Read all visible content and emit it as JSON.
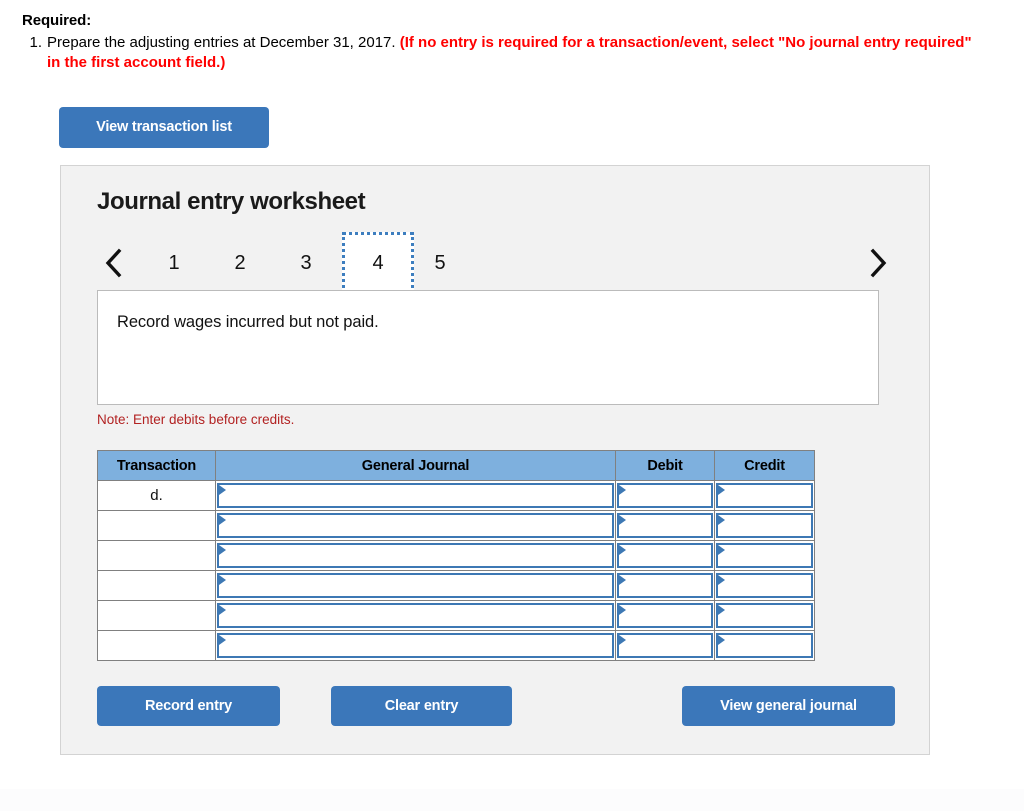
{
  "required": {
    "heading": "Required:",
    "item_number": "1.",
    "item_text_plain": "Prepare the adjusting entries at December 31, 2017. ",
    "item_text_warning": "(If no entry is required for a transaction/event, select \"No journal entry required\" in the first account field.)"
  },
  "toolbar": {
    "view_transaction_list_label": "View transaction list"
  },
  "worksheet": {
    "title": "Journal entry worksheet",
    "pager": {
      "prev_icon": "chevron-left-icon",
      "next_icon": "chevron-right-icon",
      "pages": [
        "1",
        "2",
        "3",
        "4",
        "5"
      ],
      "active_page": "4"
    },
    "description": "Record wages incurred but not paid.",
    "note": "Note: Enter debits before credits.",
    "table": {
      "headers": [
        "Transaction",
        "General Journal",
        "Debit",
        "Credit"
      ],
      "rows": [
        {
          "transaction": "d.",
          "general_journal": "",
          "debit": "",
          "credit": ""
        },
        {
          "transaction": "",
          "general_journal": "",
          "debit": "",
          "credit": ""
        },
        {
          "transaction": "",
          "general_journal": "",
          "debit": "",
          "credit": ""
        },
        {
          "transaction": "",
          "general_journal": "",
          "debit": "",
          "credit": ""
        },
        {
          "transaction": "",
          "general_journal": "",
          "debit": "",
          "credit": ""
        },
        {
          "transaction": "",
          "general_journal": "",
          "debit": "",
          "credit": ""
        }
      ]
    },
    "actions": {
      "record_entry_label": "Record entry",
      "clear_entry_label": "Clear entry",
      "view_general_journal_label": "View general journal"
    }
  },
  "colors": {
    "button_blue": "#3b77ba",
    "header_blue": "#7eb0de",
    "field_border_blue": "#3d78b4",
    "warning_red": "#ff0000",
    "note_red": "#b22222",
    "panel_bg": "#f2f2f2"
  }
}
